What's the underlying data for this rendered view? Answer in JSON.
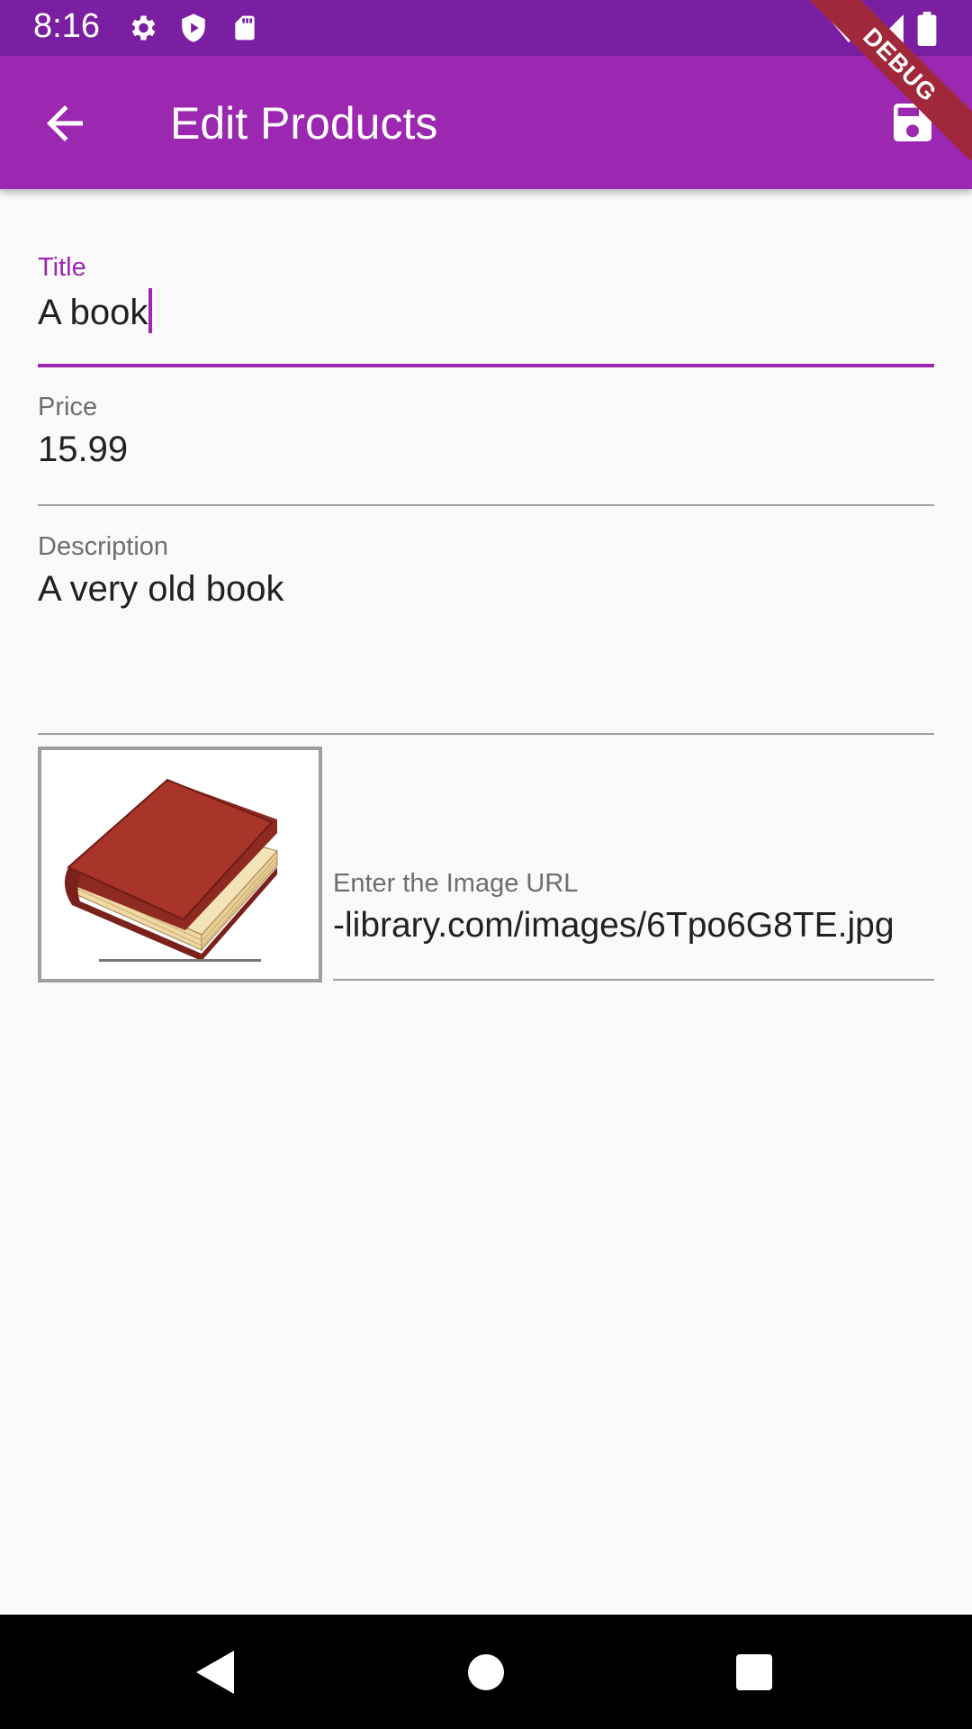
{
  "status_bar": {
    "time": "8:16",
    "icons": [
      "settings-icon",
      "shield-icon",
      "sd-card-icon",
      "wifi-icon",
      "signal-icon",
      "battery-icon"
    ]
  },
  "app_bar": {
    "title": "Edit Products",
    "back_icon": "arrow-back-icon",
    "save_icon": "save-icon",
    "color": "#9c27b0"
  },
  "debug_banner": "DEBUG",
  "form": {
    "title": {
      "label": "Title",
      "value": "A book"
    },
    "price": {
      "label": "Price",
      "value": "15.99"
    },
    "description": {
      "label": "Description",
      "value": "A very old book"
    },
    "image_url": {
      "label": "Enter the Image URL",
      "value": "-library.com/images/6Tpo6G8TE.jpg"
    }
  },
  "nav_bar": {
    "icons": [
      "back-triangle-icon",
      "home-circle-icon",
      "recents-square-icon"
    ]
  }
}
